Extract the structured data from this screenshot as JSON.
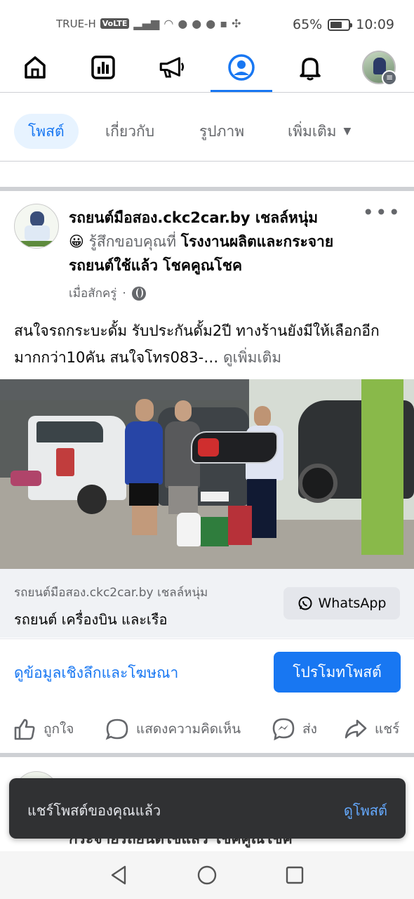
{
  "status_bar": {
    "carrier": "TRUE-H",
    "network_badge": "VoLTE",
    "icons": [
      "signal-icon",
      "wifi-icon",
      "facebook-icon",
      "messenger-icon",
      "line-icon",
      "trueid-icon",
      "pinwheel-icon"
    ],
    "battery_percent": "65%",
    "battery_level": 0.65,
    "time": "10:09"
  },
  "top_nav": {
    "items": [
      "home-icon",
      "dashboard-icon",
      "megaphone-icon",
      "profile-icon",
      "bell-icon",
      "avatar-menu"
    ],
    "active_index": 3
  },
  "profile_tabs": {
    "posts": "โพสต์",
    "about": "เกี่ยวกับ",
    "photos": "รูปภาพ",
    "more": "เพิ่มเติม"
  },
  "post": {
    "author": "รถยนต์มือสอง.ckc2car.by เชลล์หนุ่ม",
    "emoji": "😀",
    "feeling": "รู้สึกขอบคุณที่",
    "place": "โรงงานผลิตและกระจายรถยนต์ใช้แล้ว โชคคูณโชค",
    "time": "เมื่อสักครู่",
    "dot": "·",
    "body": "สนใจรถกระบะดั้ม รับประกันดั้ม2ปี ทางร้านยังมีให้เลือกอีกมากกว่า10คัน สนใจโทร083-…",
    "see_more": "ดูเพิ่มเติม",
    "more_menu": "•••",
    "link": {
      "domain": "รถยนต์มือสอง.ckc2car.by เชลล์หนุ่ม",
      "title": "รถยนต์ เครื่องบิน และเรือ",
      "cta": "WhatsApp"
    },
    "insights_link": "ดูข้อมูลเชิงลึกและโฆษณา",
    "promote_button": "โปรโมทโพสต์",
    "actions": {
      "like": "ถูกใจ",
      "comment": "แสดงความคิดเห็น",
      "send": "ส่ง",
      "share": "แชร์"
    }
  },
  "next_post": {
    "text": "กระจายรถยนต์ใช้แล้ว โชคคูณโชค"
  },
  "toast": {
    "message": "แชร์โพสต์ของคุณแล้ว",
    "action": "ดูโพสต์"
  },
  "colors": {
    "primary": "#1877f2",
    "secondary_text": "#65676b",
    "toast_bg": "#303133",
    "toast_action": "#64a9ff"
  }
}
